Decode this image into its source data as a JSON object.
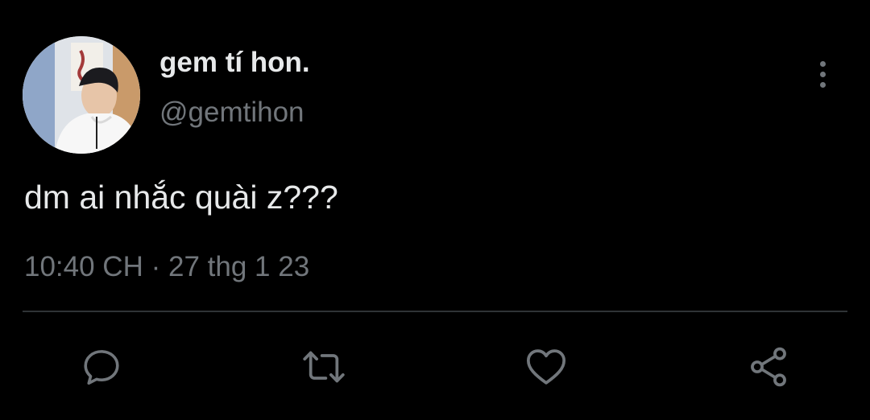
{
  "user": {
    "display_name": "gem tí hon.",
    "handle": "@gemtihon"
  },
  "tweet": {
    "text": "dm ai nhắc quài z???",
    "time": "10:40 CH",
    "separator": "·",
    "date": "27 thg 1 23"
  },
  "actions": [
    {
      "icon": "reply-icon"
    },
    {
      "icon": "retweet-icon"
    },
    {
      "icon": "like-icon"
    },
    {
      "icon": "share-icon"
    }
  ],
  "colors": {
    "background": "#000000",
    "primary_text": "#e7e9ea",
    "secondary_text": "#71767b",
    "divider": "#2f3336"
  }
}
